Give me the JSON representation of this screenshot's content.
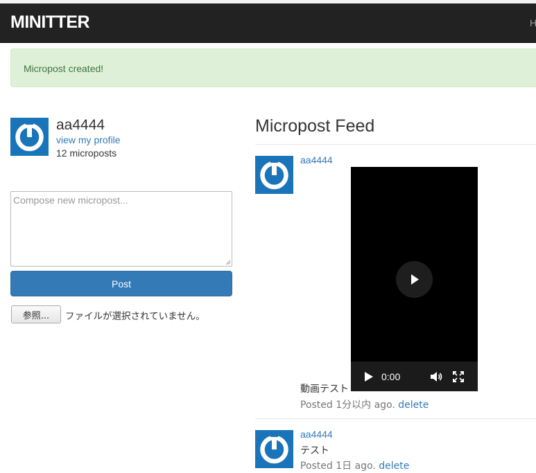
{
  "navbar": {
    "brand": "MINITTER",
    "home_link": "Home"
  },
  "alert": {
    "message": "Micropost created!"
  },
  "user": {
    "name": "aa4444",
    "view_profile": "view my profile",
    "microposts_count": "12 microposts"
  },
  "compose": {
    "placeholder": "Compose new micropost...",
    "value": "",
    "post_button": "Post",
    "browse_button": "参照...",
    "file_status": "ファイルが選択されていません。"
  },
  "feed": {
    "title": "Micropost Feed",
    "items": [
      {
        "user": "aa4444",
        "content": "動画テスト",
        "posted": "Posted 1分以内 ago.",
        "delete": "delete",
        "video": {
          "time": "0:00"
        }
      },
      {
        "user": "aa4444",
        "content": "テスト",
        "posted": "Posted 1日 ago.",
        "delete": "delete"
      }
    ]
  },
  "colors": {
    "navbar": "#222222",
    "alert_bg": "#dff0d8",
    "alert_text": "#3c763d",
    "link": "#337ab7",
    "primary_button": "#337ab7",
    "gravatar": "#1a74b9"
  }
}
